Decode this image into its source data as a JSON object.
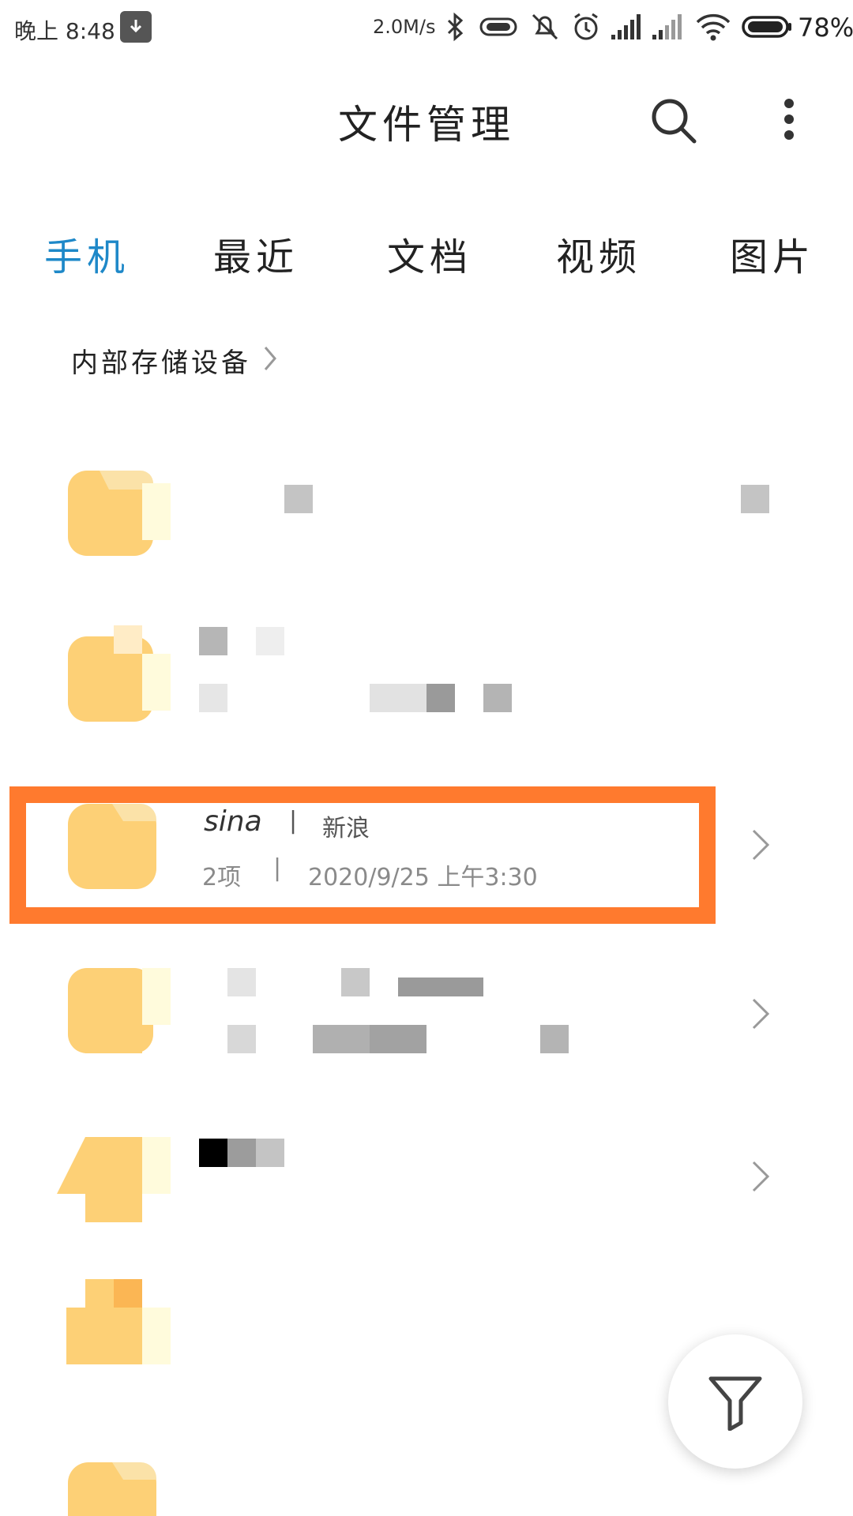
{
  "status_bar": {
    "time": "晚上 8:48",
    "net_speed": "2.0M/s",
    "battery_percent": "78%",
    "icons": [
      "download-icon",
      "bluetooth-icon",
      "nfc-icon",
      "mute-icon",
      "alarm-icon",
      "signal-icon",
      "signal-2-icon",
      "wifi-icon",
      "battery-icon"
    ]
  },
  "header": {
    "title": "文件管理",
    "search_icon": "search-icon",
    "more_icon": "more-vertical-icon"
  },
  "tabs": [
    {
      "label": "手机",
      "active": true
    },
    {
      "label": "最近",
      "active": false
    },
    {
      "label": "文档",
      "active": false
    },
    {
      "label": "视频",
      "active": false
    },
    {
      "label": "图片",
      "active": false
    }
  ],
  "breadcrumb": {
    "label": "内部存储设备"
  },
  "files": {
    "highlighted": {
      "name": "sina",
      "separator": "|",
      "alias": "新浪",
      "count": "2项",
      "date": "2020/9/25 上午3:30"
    }
  },
  "colors": {
    "accent": "#1e88c8",
    "folder": "#fdd076",
    "highlight": "#ff7a2e"
  },
  "fab": {
    "icon": "filter-icon"
  }
}
